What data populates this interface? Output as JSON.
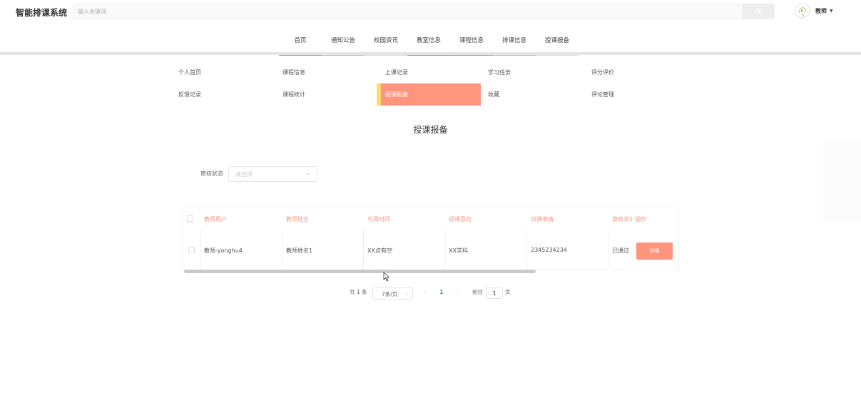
{
  "header": {
    "brand": "智能排课系统",
    "search_placeholder": "输入关键词",
    "user_name": "教师"
  },
  "nav": {
    "items": [
      {
        "label": "首页",
        "color": "#2ec2b0"
      },
      {
        "label": "通知公告",
        "color": "#ff957f"
      },
      {
        "label": "校园资讯",
        "color": "#ffd86b"
      },
      {
        "label": "教室信息",
        "color": "#4a9ee8"
      },
      {
        "label": "课程信息",
        "color": "#2ec2b0"
      },
      {
        "label": "排课信息",
        "color": "#ff957f"
      },
      {
        "label": "授课报备",
        "color": "#ffd86b"
      }
    ]
  },
  "submenu": {
    "items": [
      {
        "label": "个人首页"
      },
      {
        "label": "课程信息"
      },
      {
        "label": "上课记录"
      },
      {
        "label": "学习任务"
      },
      {
        "label": "评分评价"
      },
      {
        "label": "反馈记录"
      },
      {
        "label": "课程统计"
      },
      {
        "label": "授课报备",
        "active": true
      },
      {
        "label": "收藏"
      },
      {
        "label": "评论管理"
      }
    ]
  },
  "page_title": "授课报备",
  "filter": {
    "label": "审核状态",
    "placeholder": "请选择"
  },
  "table": {
    "headers": [
      "教师用户",
      "教师姓名",
      "可用时间",
      "授课意向",
      "排课申请",
      "审核状态",
      "操作"
    ],
    "header_visible": [
      "教师用户",
      "教师姓名",
      "可用时间",
      "授课意向",
      "排课申请",
      "审核状3",
      "操作"
    ],
    "rows": [
      {
        "teacher_user": "教师-yonghu4",
        "teacher_name": "教师姓名1",
        "available_time": "XX点有空",
        "intent": "XX学科",
        "application": "2345234234",
        "status": "已通过",
        "action": "详情"
      }
    ]
  },
  "pagination": {
    "total": "共 1 条",
    "page_size": "7条/页",
    "current_page": "1",
    "goto_label": "前往",
    "goto_value": "1",
    "page_suffix": "页"
  }
}
